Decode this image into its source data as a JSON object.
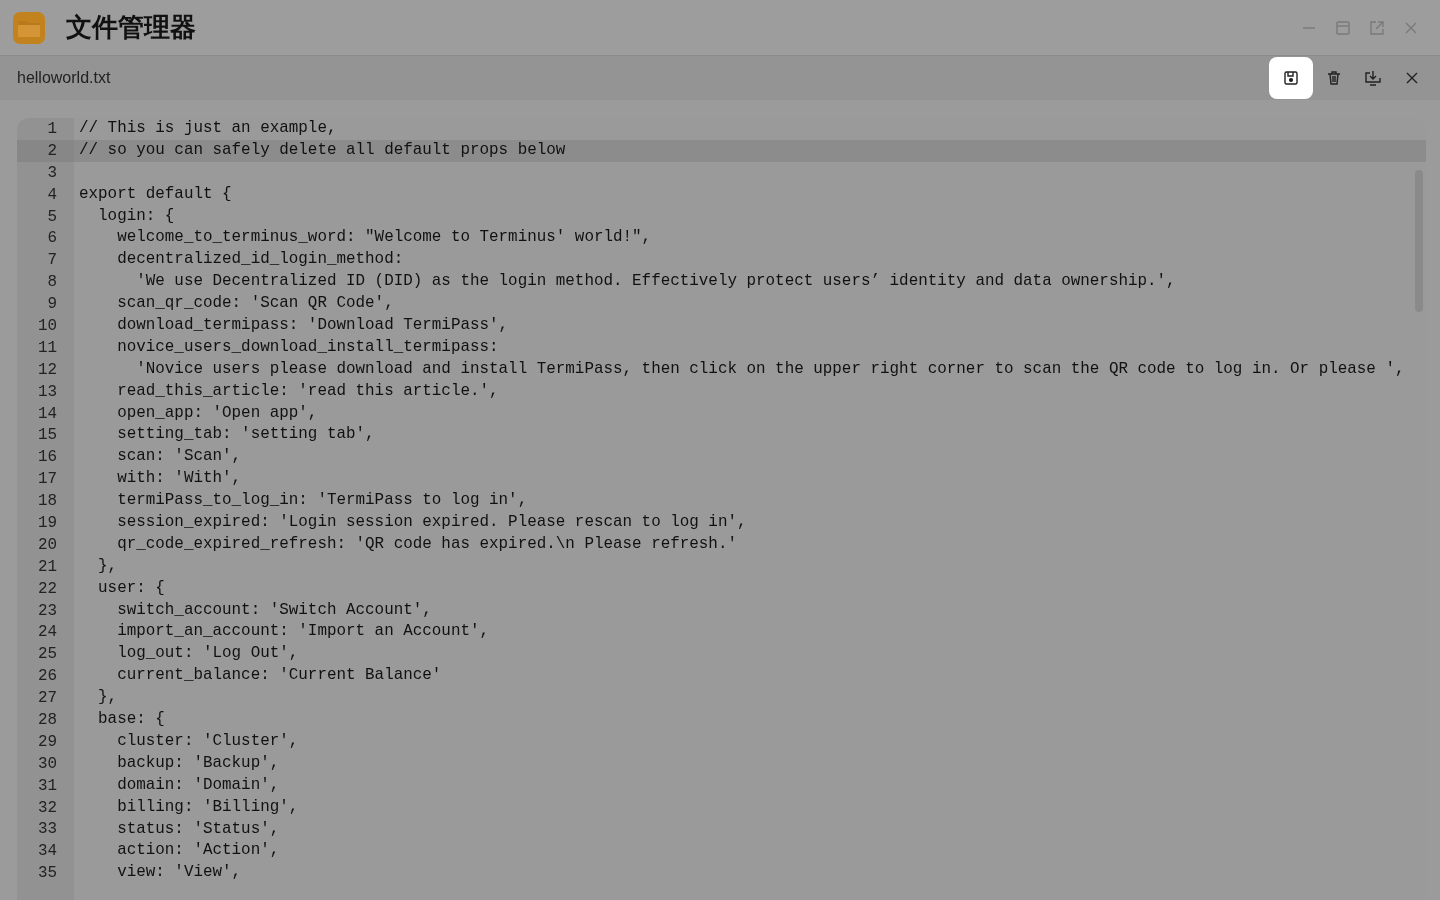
{
  "window": {
    "title": "文件管理器",
    "controls": [
      {
        "kind": "minimize"
      },
      {
        "kind": "maximize"
      },
      {
        "kind": "popout"
      },
      {
        "kind": "close"
      }
    ]
  },
  "file_bar": {
    "filename": "helloworld.txt",
    "actions": [
      {
        "kind": "save",
        "highlighted": true
      },
      {
        "kind": "delete",
        "highlighted": false
      },
      {
        "kind": "download",
        "highlighted": false
      },
      {
        "kind": "close",
        "highlighted": false
      }
    ]
  },
  "editor": {
    "lines": [
      {
        "number": "1",
        "text": "// This is just an example,",
        "current": false
      },
      {
        "number": "2",
        "text": "// so you can safely delete all default props below",
        "current": true
      },
      {
        "number": "3",
        "current": false
      },
      {
        "number": "4",
        "text": "export default {",
        "current": false
      },
      {
        "number": "5",
        "text": "  login: {",
        "current": false
      },
      {
        "number": "6",
        "text": "    welcome_to_terminus_word: \"Welcome to Terminus' world!\",",
        "current": false
      },
      {
        "number": "7",
        "text": "    decentralized_id_login_method:",
        "current": false
      },
      {
        "number": "8",
        "text": "      'We use Decentralized ID (DID) as the login method. Effectively protect users’ identity and data ownership.',",
        "current": false
      },
      {
        "number": "9",
        "text": "    scan_qr_code: 'Scan QR Code',",
        "current": false
      },
      {
        "number": "10",
        "text": "    download_termipass: 'Download TermiPass',",
        "current": false
      },
      {
        "number": "11",
        "text": "    novice_users_download_install_termipass:",
        "current": false
      },
      {
        "number": "12",
        "text": "      'Novice users please download and install TermiPass, then click on the upper right corner to scan the QR code to log in. Or please ',",
        "current": false
      },
      {
        "number": "13",
        "text": "    read_this_article: 'read this article.',",
        "current": false
      },
      {
        "number": "14",
        "text": "    open_app: 'Open app',",
        "current": false
      },
      {
        "number": "15",
        "text": "    setting_tab: 'setting tab',",
        "current": false
      },
      {
        "number": "16",
        "text": "    scan: 'Scan',",
        "current": false
      },
      {
        "number": "17",
        "text": "    with: 'With',",
        "current": false
      },
      {
        "number": "18",
        "text": "    termiPass_to_log_in: 'TermiPass to log in',",
        "current": false
      },
      {
        "number": "19",
        "text": "    session_expired: 'Login session expired. Please rescan to log in',",
        "current": false
      },
      {
        "number": "20",
        "text": "    qr_code_expired_refresh: 'QR code has expired.\\n Please refresh.'",
        "current": false
      },
      {
        "number": "21",
        "text": "  },",
        "current": false
      },
      {
        "number": "22",
        "text": "  user: {",
        "current": false
      },
      {
        "number": "23",
        "text": "    switch_account: 'Switch Account',",
        "current": false
      },
      {
        "number": "24",
        "text": "    import_an_account: 'Import an Account',",
        "current": false
      },
      {
        "number": "25",
        "text": "    log_out: 'Log Out',",
        "current": false
      },
      {
        "number": "26",
        "text": "    current_balance: 'Current Balance'",
        "current": false
      },
      {
        "number": "27",
        "text": "  },",
        "current": false
      },
      {
        "number": "28",
        "text": "  base: {",
        "current": false
      },
      {
        "number": "29",
        "text": "    cluster: 'Cluster',",
        "current": false
      },
      {
        "number": "30",
        "text": "    backup: 'Backup',",
        "current": false
      },
      {
        "number": "31",
        "text": "    domain: 'Domain',",
        "current": false
      },
      {
        "number": "32",
        "text": "    billing: 'Billing',",
        "current": false
      },
      {
        "number": "33",
        "text": "    status: 'Status',",
        "current": false
      },
      {
        "number": "34",
        "text": "    action: 'Action',",
        "current": false
      },
      {
        "number": "35",
        "text": "    view: 'View',",
        "current": false
      }
    ]
  }
}
